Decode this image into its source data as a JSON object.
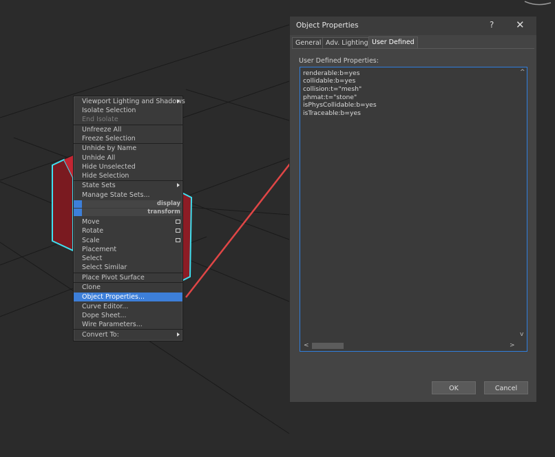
{
  "colors": {
    "accent": "#3d7fd9",
    "object_red": "#b01e2a",
    "selection_cyan": "#3fe0f0",
    "arrow_red": "#e04646"
  },
  "context_menu": {
    "items": [
      {
        "label": "Viewport Lighting and Shadows",
        "submenu": true
      },
      {
        "label": "Isolate Selection"
      },
      {
        "label": "End Isolate",
        "disabled": true
      },
      {
        "label": "Unfreeze All"
      },
      {
        "label": "Freeze Selection"
      },
      {
        "label": "Unhide by Name"
      },
      {
        "label": "Unhide All"
      },
      {
        "label": "Hide Unselected"
      },
      {
        "label": "Hide Selection"
      },
      {
        "label": "State Sets",
        "submenu": true
      },
      {
        "label": "Manage State Sets..."
      },
      {
        "label": "display",
        "band": true
      },
      {
        "label": "transform",
        "band": true
      },
      {
        "label": "Move",
        "options_box": true
      },
      {
        "label": "Rotate",
        "options_box": true
      },
      {
        "label": "Scale",
        "options_box": true
      },
      {
        "label": "Placement"
      },
      {
        "label": "Select"
      },
      {
        "label": "Select Similar"
      },
      {
        "label": "Place Pivot Surface"
      },
      {
        "label": "Clone"
      },
      {
        "label": "Object Properties...",
        "highlighted": true
      },
      {
        "label": "Curve Editor..."
      },
      {
        "label": "Dope Sheet..."
      },
      {
        "label": "Wire Parameters..."
      },
      {
        "label": "Convert To:",
        "submenu": true
      }
    ]
  },
  "dialog": {
    "title": "Object Properties",
    "help": "?",
    "close": "✕",
    "tabs": [
      "General",
      "Adv. Lighting",
      "User Defined"
    ],
    "active_tab": "User Defined",
    "section_label": "User Defined Properties:",
    "properties_lines": [
      "renderable:b=yes",
      "collidable:b=yes",
      "collision:t=\"mesh\"",
      "phmat:t=\"stone\"",
      "isPhysCollidable:b=yes",
      "isTraceable:b=yes"
    ],
    "scroll_left": "<",
    "scroll_right": ">",
    "scroll_up": "^",
    "scroll_down": "v",
    "ok_label": "OK",
    "cancel_label": "Cancel"
  }
}
